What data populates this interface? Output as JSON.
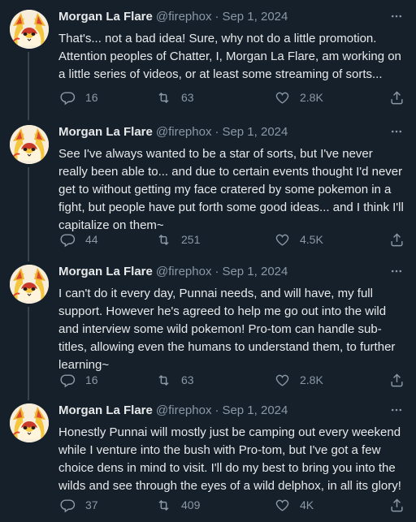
{
  "author": {
    "name": "Morgan La Flare",
    "handle": "@firephox",
    "separator": "·",
    "date": "Sep 1, 2024"
  },
  "tweets": [
    {
      "text": "That's... not a bad idea! Sure, why not do a little promotion. Attention peoples of Chatter, I, Morgan La Flare, am working on a little series of videos, or at least some streaming of sorts...",
      "replies": "16",
      "retweets": "63",
      "likes": "2.8K"
    },
    {
      "text": "See I've always wanted to be a star of sorts, but I've never really been able to... and due to certain events thought I'd never get to without getting my face cratered by some pokemon in a fight, but people have put forth some good ideas... and I think I'll capitalize on them~",
      "replies": "44",
      "retweets": "251",
      "likes": "4.5K"
    },
    {
      "text": "I can't do it every day, Punnai needs, and will have, my full support. However he's agreed to help me go out into the wild and interview some wild pokemon! Pro-tom can handle sub-titles, allowing even the humans to understand them, to further learning~",
      "replies": "16",
      "retweets": "63",
      "likes": "2.8K"
    },
    {
      "text": "Honestly Punnai will mostly just be camping out every weekend while I venture into the bush with Pro-tom, but I've got a few choice dens in mind to visit. I'll do my best to bring you into the wilds and see through the eyes of a wild delphox, in all its glory!",
      "replies": "37",
      "retweets": "409",
      "likes": "4K"
    }
  ],
  "icons": {
    "reply": "reply-icon",
    "retweet": "retweet-icon",
    "like": "heart-icon",
    "share": "share-icon",
    "more": "more-icon"
  },
  "colors": {
    "background": "#15202b",
    "text": "#e7e9ea",
    "muted": "#8b98a5",
    "thread_line": "#38444d"
  }
}
